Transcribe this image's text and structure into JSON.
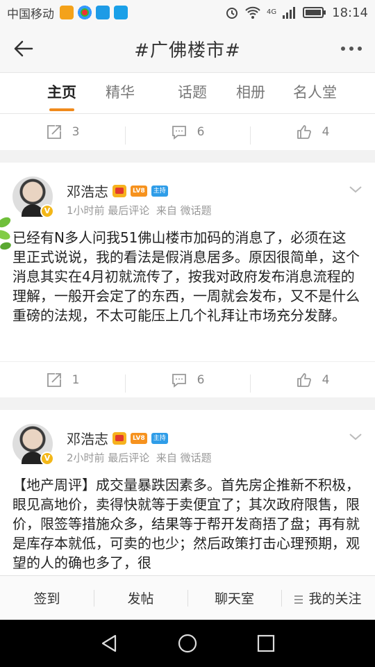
{
  "status_bar": {
    "carrier": "中国移动",
    "network": "4G",
    "time": "18:14"
  },
  "header": {
    "title": "#广佛楼市#",
    "back_icon": "arrow-left-icon",
    "more_icon": "more-dots-icon"
  },
  "tabs": [
    {
      "label": "主页",
      "active": true
    },
    {
      "label": "精华",
      "active": false
    },
    {
      "label": "话题",
      "active": false
    },
    {
      "label": "相册",
      "active": false
    },
    {
      "label": "名人堂",
      "active": false
    }
  ],
  "top_actions": {
    "repost": "3",
    "comment": "6",
    "like": "4"
  },
  "posts": [
    {
      "author": "邓浩志",
      "level_badge": "LV8",
      "host_badge": "主持",
      "time": "1小时前 最后评论",
      "source": "来自 微话题",
      "content": "已经有N多人问我51佛山楼市加码的消息了，必须在这里正式说说，我的看法是假消息居多。原因很简单，这个消息其实在4月初就流传了，按我对政府发布消息流程的理解，一般开会定了的东西，一周就会发布，又不是什么重磅的法规，不太可能压上几个礼拜让市场充分发酵。",
      "repost": "1",
      "comment": "6",
      "like": "4"
    },
    {
      "author": "邓浩志",
      "level_badge": "LV8",
      "host_badge": "主持",
      "time": "2小时前 最后评论",
      "source": "来自 微话题",
      "content": "【地产周评】成交量暴跌因素多。首先房企推新不积极，眼见高地价，卖得快就等于卖便宜了；其次政府限售，限价，限签等措施众多，结果等于帮开发商捂了盘；再有就是库存本就低，可卖的也少；然后政策打击心理预期，观望的人的确也多了，很"
    }
  ],
  "bottom_bar": {
    "checkin": "签到",
    "post": "发帖",
    "chat": "聊天室",
    "following": "我的关注"
  },
  "colors": {
    "accent": "#f08a1c",
    "host_badge": "#2f9de8",
    "level_badge": "#f6921e"
  }
}
